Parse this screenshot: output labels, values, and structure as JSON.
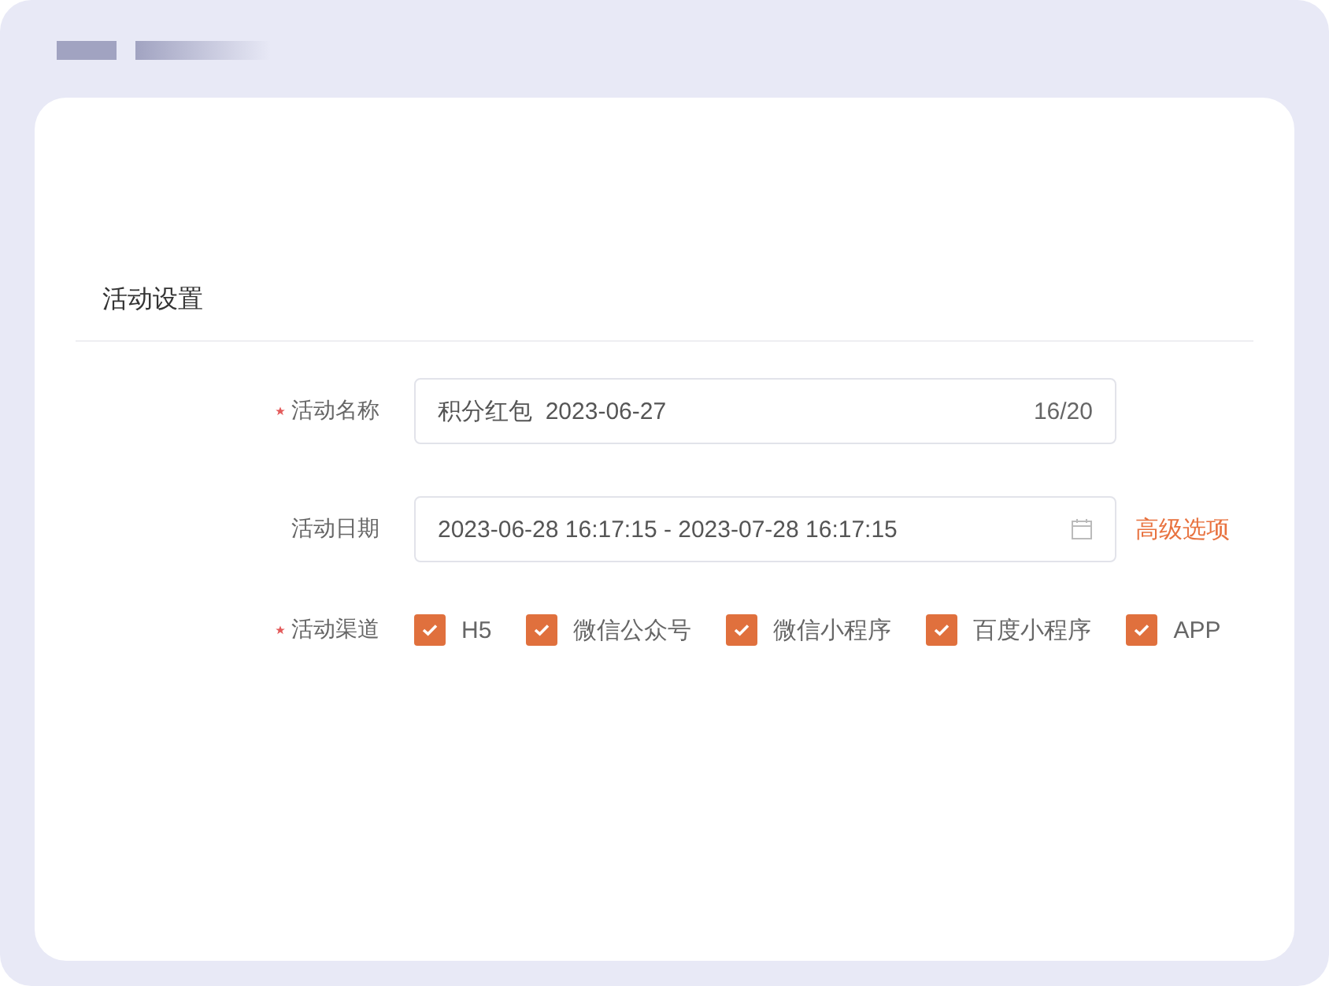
{
  "section_title": "活动设置",
  "fields": [
    {
      "kind": "text",
      "label": "活动名称",
      "required": true,
      "value": "积分红包  2023-06-27",
      "counter": "16/20"
    },
    {
      "kind": "date_range",
      "label": "活动日期",
      "required": false,
      "value": "2023-06-28 16:17:15 - 2023-07-28 16:17:15",
      "link": "高级选项"
    },
    {
      "kind": "checkboxes",
      "label": "活动渠道",
      "required": true,
      "options": [
        {
          "label": "H5",
          "checked": true
        },
        {
          "label": "微信公众号",
          "checked": true
        },
        {
          "label": "微信小程序",
          "checked": true
        },
        {
          "label": "百度小程序",
          "checked": true
        },
        {
          "label": "APP",
          "checked": true
        }
      ]
    }
  ]
}
